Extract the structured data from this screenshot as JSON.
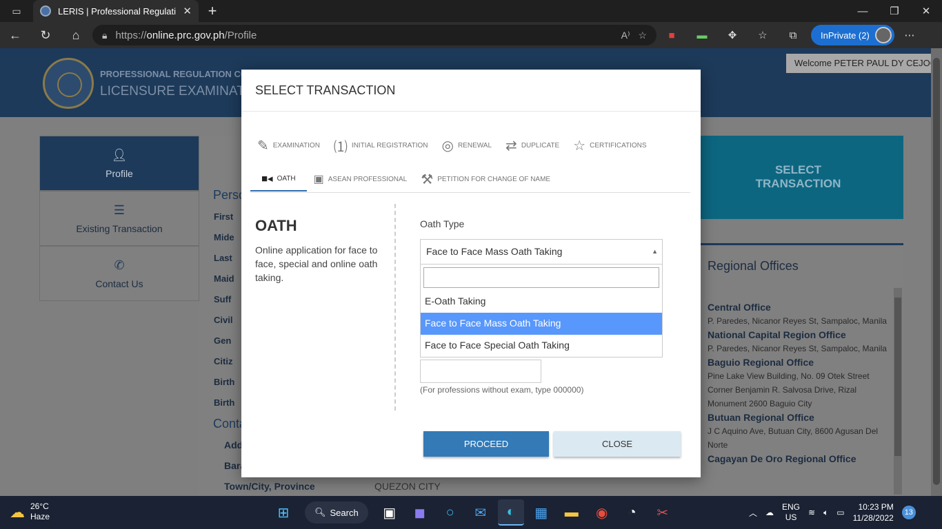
{
  "browser": {
    "tab_title": "LERIS | Professional Regulation C",
    "url_prefix": "https://",
    "url_domain": "online.prc.gov.ph",
    "url_path": "/Profile",
    "inprivate_label": "InPrivate (2)"
  },
  "site_header": {
    "line1": "PROFESSIONAL REGULATION CO",
    "line2": "LICENSURE EXAMINAT",
    "welcome": "Welcome PETER PAUL DY CEJOCO"
  },
  "sidebar": {
    "items": [
      {
        "label": "Profile"
      },
      {
        "label": "Existing Transaction"
      },
      {
        "label": "Contact Us"
      }
    ]
  },
  "background_form": {
    "person_title": "Perso",
    "person_labels": [
      "First",
      "Mide",
      "Last",
      "Maid",
      "Suff",
      "Civil",
      "Gen",
      "Citiz",
      "Birth",
      "Birth"
    ],
    "contact_title": "Conta",
    "contact_labels": [
      "Add",
      "Bara"
    ],
    "town_label": "Town/City, Province",
    "town_value": "QUEZON CITY"
  },
  "select_transaction_button": "SELECT TRANSACTION",
  "regional_offices": {
    "title": "Regional Offices",
    "offices": [
      {
        "name": "Central Office",
        "address": "P. Paredes, Nicanor Reyes St, Sampaloc, Manila"
      },
      {
        "name": "National Capital Region Office",
        "address": "P. Paredes, Nicanor Reyes St, Sampaloc, Manila"
      },
      {
        "name": "Baguio Regional Office",
        "address": "Pine Lake View Building, No. 09 Otek Street Corner Benjamin R. Salvosa Drive, Rizal Monument 2600 Baguio City"
      },
      {
        "name": "Butuan Regional Office",
        "address": "J C Aquino Ave, Butuan City, 8600 Agusan Del Norte"
      },
      {
        "name": "Cagayan De Oro Regional Office",
        "address": ""
      }
    ]
  },
  "modal": {
    "title": "SELECT TRANSACTION",
    "tabs_row1": [
      {
        "label": "EXAMINATION",
        "icon": "pencil-icon"
      },
      {
        "label": "INITIAL REGISTRATION",
        "icon": "number-one-icon"
      },
      {
        "label": "RENEWAL",
        "icon": "fingerprint-icon"
      },
      {
        "label": "DUPLICATE",
        "icon": "repeat-icon"
      },
      {
        "label": "CERTIFICATIONS",
        "icon": "star-icon"
      }
    ],
    "tabs_row2": [
      {
        "label": "OATH",
        "icon": "video-camera-icon",
        "active": true
      },
      {
        "label": "ASEAN PROFESSIONAL",
        "icon": "id-badge-icon"
      },
      {
        "label": "PETITION FOR CHANGE OF NAME",
        "icon": "gavel-icon"
      }
    ],
    "heading": "OATH",
    "description": "Online application for face to face, special and online oath taking.",
    "oath_type_label": "Oath Type",
    "oath_type_selected": "Face to Face Mass Oath Taking",
    "search_value": "",
    "options": [
      "E-Oath Taking",
      "Face to Face Mass Oath Taking",
      "Face to Face Special Oath Taking"
    ],
    "highlighted_option": "Face to Face Mass Oath Taking",
    "hint": "(For professions without exam, type 000000)",
    "proceed_label": "PROCEED",
    "close_label": "CLOSE"
  },
  "taskbar": {
    "temperature": "26°C",
    "weather": "Haze",
    "search_label": "Search",
    "lang_top": "ENG",
    "lang_bottom": "US",
    "time": "10:23 PM",
    "date": "11/28/2022",
    "notification_count": "13"
  },
  "colors": {
    "primary_button": "#337ab7",
    "highlight_option": "#5897fb",
    "header_navy": "#1d3a5a",
    "select_tx_teal": "#0d6680"
  }
}
